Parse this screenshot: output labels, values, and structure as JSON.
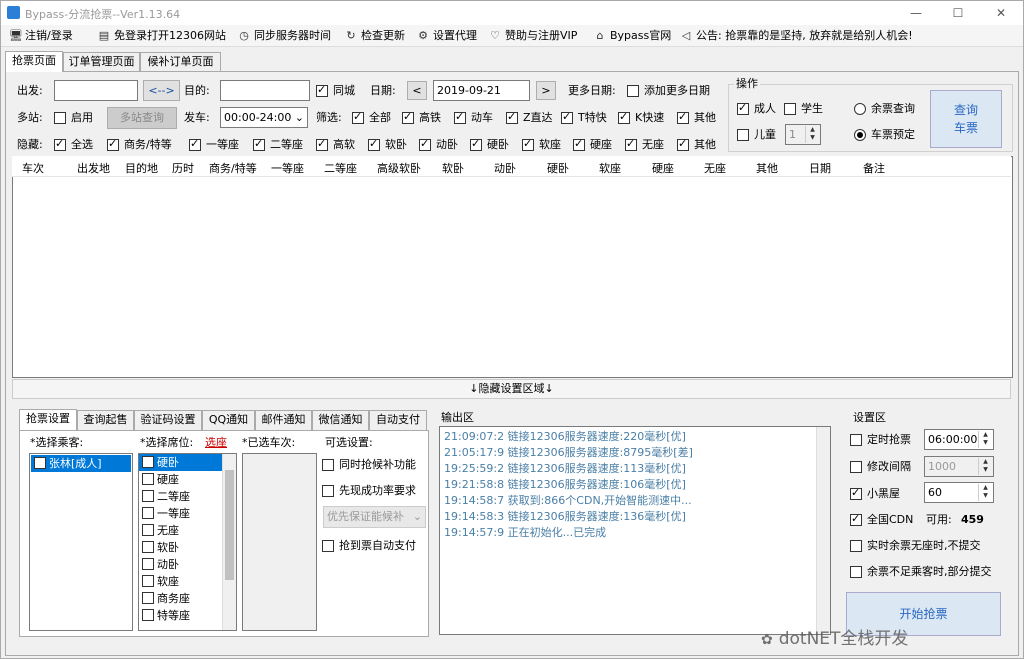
{
  "window": {
    "title": "Bypass-分流抢票--Ver1.13.64",
    "minimize": "—",
    "maximize": "☐",
    "close": "✕"
  },
  "menu": [
    {
      "icon": "🖥",
      "label": "注销/登录"
    },
    {
      "icon": "▤",
      "label": "免登录打开12306网站"
    },
    {
      "icon": "◷",
      "label": "同步服务器时间"
    },
    {
      "icon": "↻",
      "label": "检查更新"
    },
    {
      "icon": "⚙",
      "label": "设置代理"
    },
    {
      "icon": "♡",
      "label": "赞助与注册VIP"
    },
    {
      "icon": "⌂",
      "label": "Bypass官网"
    },
    {
      "icon": "◁",
      "label": "公告: 抢票靠的是坚持, 放弃就是给别人机会!"
    }
  ],
  "tabs": [
    "抢票页面",
    "订单管理页面",
    "候补订单页面"
  ],
  "search": {
    "from_label": "出发:",
    "from_value": "",
    "swap_label": "<-->",
    "to_label": "目的:",
    "to_value": "",
    "same_city_label": "同城",
    "date_label": "日期:",
    "date_value": "2019-09-21",
    "prev": "<",
    "next": ">",
    "more_dates_label": "更多日期:",
    "add_dates_label": "添加更多日期",
    "multi_label": "多站:",
    "enable_label": "启用",
    "multi_query_btn": "多站查询",
    "depart_label": "发车:",
    "depart_value": "00:00-24:00",
    "filter_label": "筛选:",
    "filters": [
      "全部",
      "高铁",
      "动车",
      "Z直达",
      "T特快",
      "K快速",
      "其他"
    ],
    "hide_label": "隐藏:",
    "hides": [
      "全选",
      "商务/特等",
      "一等座",
      "二等座",
      "高软",
      "软卧",
      "动卧",
      "硬卧",
      "软座",
      "硬座",
      "无座",
      "其他"
    ]
  },
  "ops": {
    "title": "操作",
    "adult": "成人",
    "student": "学生",
    "child": "儿童",
    "child_count": "1",
    "remain_query": "余票查询",
    "reserve": "车票预定",
    "query_btn_1": "查询",
    "query_btn_2": "车票"
  },
  "grid_headers": [
    "车次",
    "出发地",
    "目的地",
    "历时",
    "商务/特等",
    "一等座",
    "二等座",
    "高级软卧",
    "软卧",
    "动卧",
    "硬卧",
    "软座",
    "硬座",
    "无座",
    "其他",
    "日期",
    "备注"
  ],
  "hidden_area": "↓隐藏设置区域↓",
  "bottom_tabs": [
    "抢票设置",
    "查询起售",
    "验证码设置",
    "QQ通知",
    "邮件通知",
    "微信通知",
    "自动支付"
  ],
  "settings": {
    "passenger_label": "*选择乘客:",
    "passengers": [
      "张林[成人]"
    ],
    "seat_label": "*选择席位:",
    "seat_link": "选座",
    "seats": [
      "硬卧",
      "硬座",
      "二等座",
      "一等座",
      "无座",
      "软卧",
      "动卧",
      "软座",
      "商务座",
      "特等座"
    ],
    "trains_label": "*已选车次:",
    "optional_label": "可选设置:",
    "opt_1": "同时抢候补功能",
    "opt_2": "先现成功率要求",
    "opt_combo": "优先保证能候补",
    "opt_3": "抢到票自动支付"
  },
  "output": {
    "title": "输出区",
    "lines": [
      "21:09:07:2   链接12306服务器速度:220毫秒[优]",
      "21:05:17:9   链接12306服务器速度:8795毫秒[差]",
      "19:25:59:2   链接12306服务器速度:113毫秒[优]",
      "19:21:58:8   链接12306服务器速度:106毫秒[优]",
      "19:14:58:7   获取到:866个CDN,开始智能测速中...",
      "19:14:58:3   链接12306服务器速度:136毫秒[优]",
      "19:14:57:9   正在初始化...已完成"
    ]
  },
  "settings_area": {
    "title": "设置区",
    "timed_label": "定时抢票",
    "timed_value": "06:00:00",
    "interval_label": "修改间隔",
    "interval_value": "1000",
    "blackroom_label": "小黑屋",
    "blackroom_value": "60",
    "cdn_label": "全国CDN",
    "cdn_avail_label": "可用:",
    "cdn_avail_value": "459",
    "realtime_label": "实时余票无座时,不提交",
    "partial_label": "余票不足乘客时,部分提交",
    "start_btn": "开始抢票"
  },
  "watermark": "dotNET全栈开发"
}
